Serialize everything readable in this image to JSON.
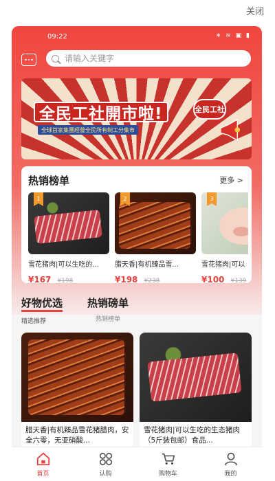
{
  "window": {
    "close_label": "关闭"
  },
  "status_bar": {
    "time": "09:22",
    "icons": "∗ ≋ ▣ ▮"
  },
  "search": {
    "placeholder": "请输入关键字"
  },
  "banner": {
    "title": "全民工社開市啦!",
    "subtitle": "全球首家集團經營全民所有制工分集市",
    "logo_text": "全民工社"
  },
  "hot_list": {
    "title": "热销榜单",
    "more_label": "更多 >",
    "items": [
      {
        "rank": "1",
        "name": "雪花猪肉|可以生吃的...",
        "price": "¥167",
        "old_price": "¥198"
      },
      {
        "rank": "2",
        "name": "腊天香|有机臻品雪...",
        "price": "¥198",
        "old_price": "¥238"
      },
      {
        "rank": "3",
        "name": "雪花猪肉|可以",
        "price": "¥100",
        "old_price": "¥139"
      }
    ]
  },
  "tabs": [
    {
      "label": "好物优选",
      "sub": "精选推荐",
      "active": true
    },
    {
      "label": "热销磅单",
      "sub": "热销榜单",
      "active": false
    }
  ],
  "products": [
    {
      "name": "腊天香|有机臻品雪花猪腊肉，安全六零，无亚硝酸..."
    },
    {
      "name": "雪花猪肉|可以生吃的生态猪肉（5斤装包邮）食品..."
    }
  ],
  "bottom_nav": [
    {
      "label": "首页",
      "icon": "home-icon",
      "active": true
    },
    {
      "label": "认购",
      "icon": "grid-icon",
      "active": false
    },
    {
      "label": "购物车",
      "icon": "cart-icon",
      "active": false
    },
    {
      "label": "我的",
      "icon": "user-icon",
      "active": false
    }
  ],
  "colors": {
    "brand_red": "#e8423c",
    "rank_badge": "#f29a2e"
  }
}
